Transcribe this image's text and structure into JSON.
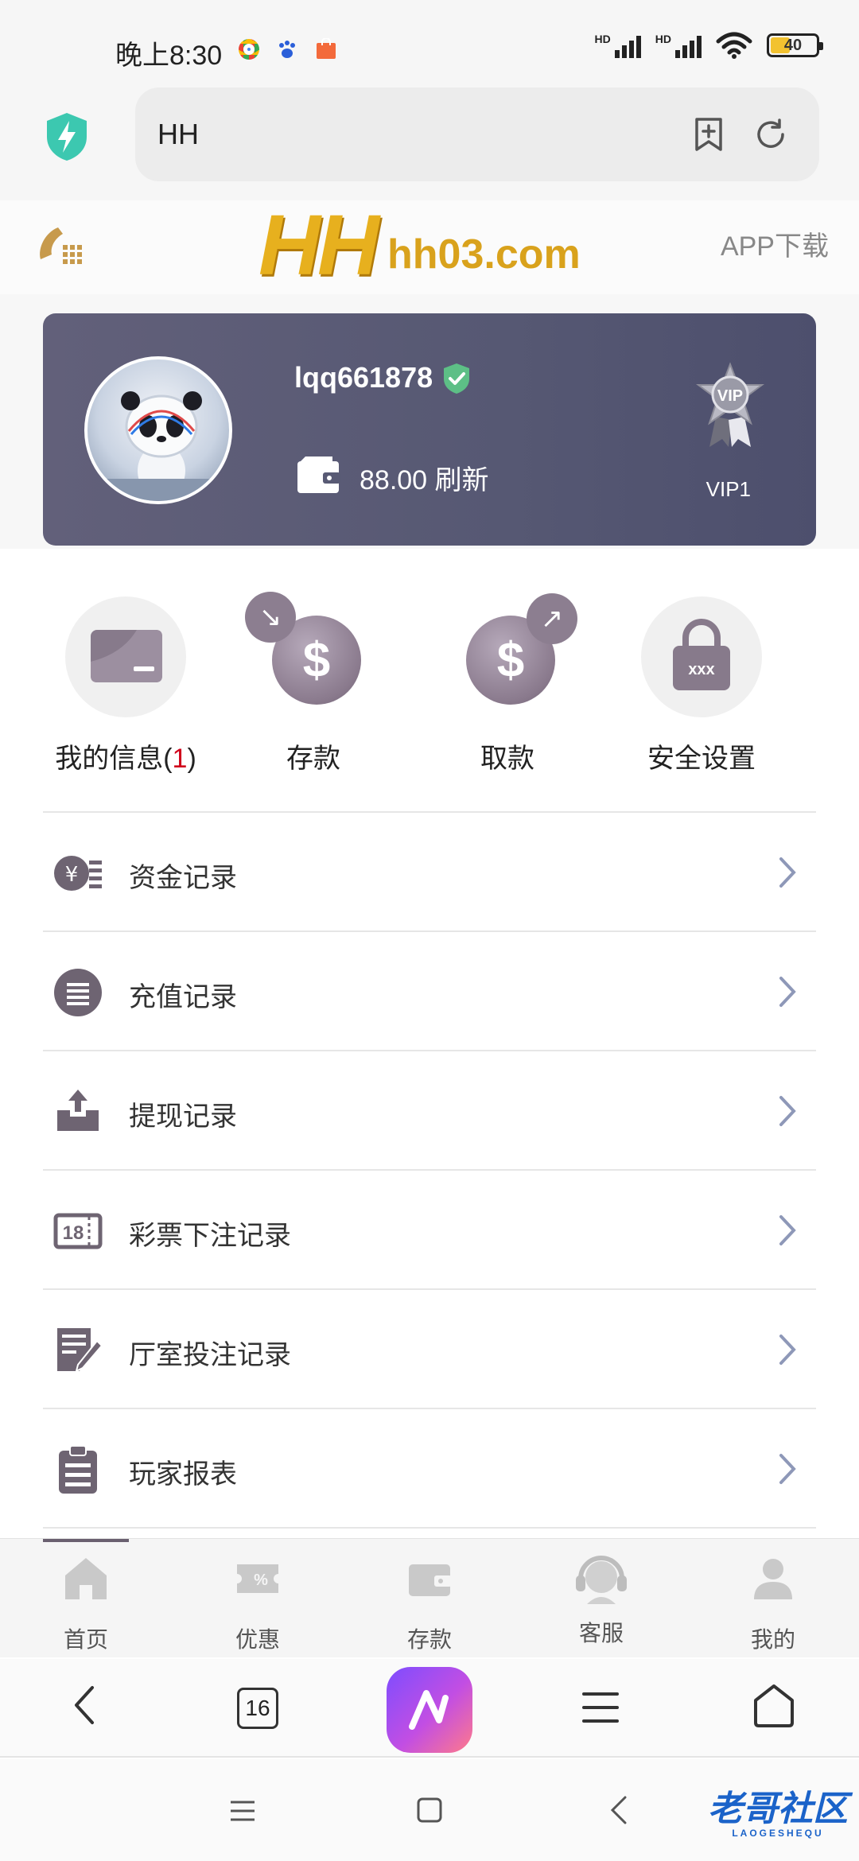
{
  "status_bar": {
    "time": "晚上8:30",
    "hd1": "HD",
    "hd2": "HD",
    "battery": "40"
  },
  "browser": {
    "url_text": "HH",
    "tab_count": "16"
  },
  "site": {
    "logo_main": "HH",
    "logo_domain": "hh03.com",
    "app_download": "APP下载"
  },
  "profile": {
    "username": "lqq661878",
    "balance": "88.00",
    "refresh": "刷新",
    "vip_level": "VIP1",
    "vip_badge_text": "VIP"
  },
  "quick_actions": [
    {
      "label": "我的信息(",
      "count": "1",
      "suffix": ")"
    },
    {
      "label": "存款"
    },
    {
      "label": "取款"
    },
    {
      "label": "安全设置"
    }
  ],
  "menu": [
    {
      "label": "资金记录",
      "icon": "yen-list-icon"
    },
    {
      "label": "充值记录",
      "icon": "list-circle-icon"
    },
    {
      "label": "提现记录",
      "icon": "upload-tray-icon"
    },
    {
      "label": "彩票下注记录",
      "icon": "ticket-18-icon"
    },
    {
      "label": "厅室投注记录",
      "icon": "edit-note-icon"
    },
    {
      "label": "玩家报表",
      "icon": "clipboard-icon"
    }
  ],
  "tabbar": [
    {
      "label": "首页",
      "icon": "home-icon"
    },
    {
      "label": "优惠",
      "icon": "coupon-icon"
    },
    {
      "label": "存款",
      "icon": "wallet-icon"
    },
    {
      "label": "客服",
      "icon": "headset-icon"
    },
    {
      "label": "我的",
      "icon": "user-icon"
    }
  ],
  "watermark": {
    "main": "老哥社区",
    "sub": "LAOGESHEQU"
  },
  "colors": {
    "card_bg": "#585a74",
    "logo_gold": "#e7b01e",
    "accent_red": "#d0021b",
    "icon_gray": "#8a7a8d"
  }
}
